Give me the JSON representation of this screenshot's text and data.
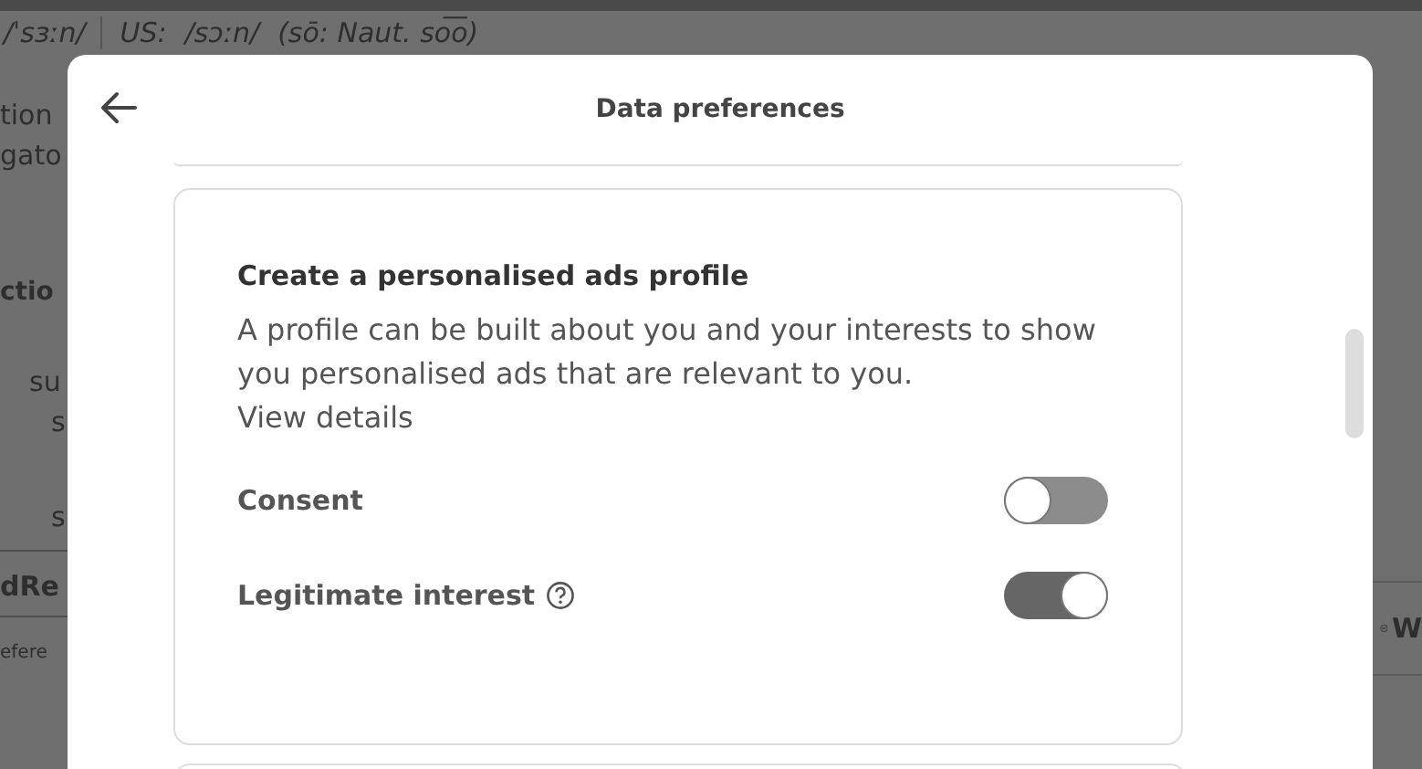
{
  "background_page": {
    "pronunciation": [
      "/ˈsɜːn/",
      "US:",
      "/sɔːn/",
      "(sō: Naut. so͞o)"
    ],
    "left_fragments": [
      "tion",
      "gato",
      "ctio",
      "su",
      "s",
      "s",
      "dRe",
      "efere"
    ],
    "right_fragment": "W"
  },
  "dialog": {
    "title": "Data preferences",
    "card": {
      "heading": "Create a personalised ads profile",
      "description": "A profile can be built about you and your interests to show you personalised ads that are relevant to you.",
      "link": "View details",
      "options": [
        {
          "label": "Consent",
          "help": false,
          "on": false
        },
        {
          "label": "Legitimate interest",
          "help": true,
          "on": true
        }
      ]
    }
  }
}
